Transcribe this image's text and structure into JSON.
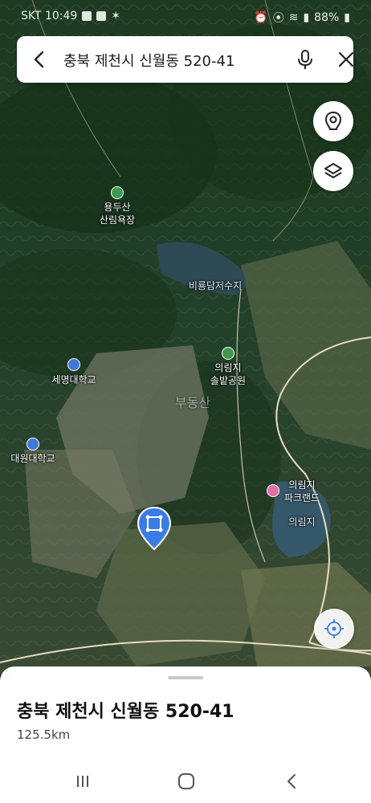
{
  "status_bar": {
    "carrier_time": "SKT 10:49",
    "battery": "88%"
  },
  "search": {
    "query": "충북 제천시 신월동 520-41"
  },
  "map": {
    "labels": {
      "yongdusan": [
        "용두산",
        "산림욕장"
      ],
      "reservoir": "비룡담저수지",
      "uirimji_park": [
        "의림지",
        "솔밭공원"
      ],
      "semyung": "세명대학교",
      "daewon": "대원대학교",
      "uirimji_parkland": [
        "의림지",
        "파크랜드"
      ],
      "uirimji": "의림지"
    },
    "watermark": "부동산"
  },
  "place": {
    "title": "충북 제천시 신월동 520-41",
    "distance": "125.5km"
  },
  "colors": {
    "pin": "#3a7ce6",
    "poi_green": "#3e9a4c",
    "poi_blue": "#3f78d6",
    "poi_pink": "#e16fa5"
  }
}
